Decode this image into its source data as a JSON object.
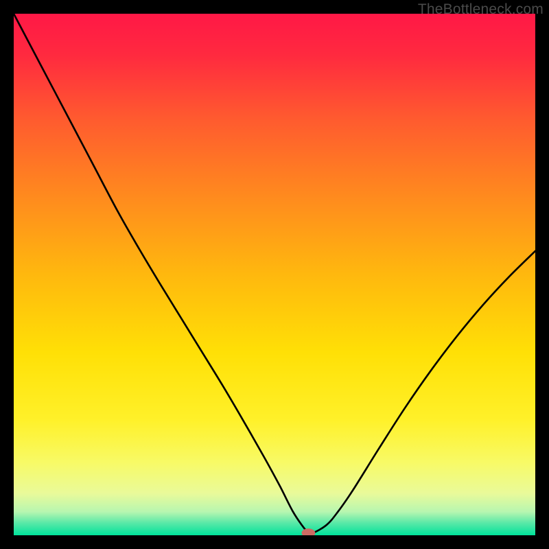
{
  "watermark": "TheBottleneck.com",
  "chart_data": {
    "type": "line",
    "title": "",
    "xlabel": "",
    "ylabel": "",
    "xlim": [
      0,
      100
    ],
    "ylim": [
      0,
      100
    ],
    "background_gradient": {
      "stops": [
        {
          "offset": 0.0,
          "color": "#ff1846"
        },
        {
          "offset": 0.08,
          "color": "#ff2a3f"
        },
        {
          "offset": 0.2,
          "color": "#ff5a2f"
        },
        {
          "offset": 0.35,
          "color": "#ff8a1e"
        },
        {
          "offset": 0.5,
          "color": "#ffb80e"
        },
        {
          "offset": 0.65,
          "color": "#ffe006"
        },
        {
          "offset": 0.78,
          "color": "#fff12a"
        },
        {
          "offset": 0.86,
          "color": "#f8fa66"
        },
        {
          "offset": 0.92,
          "color": "#e9fa9a"
        },
        {
          "offset": 0.955,
          "color": "#b7f6b0"
        },
        {
          "offset": 0.975,
          "color": "#5fe9a8"
        },
        {
          "offset": 1.0,
          "color": "#00e29b"
        }
      ]
    },
    "series": [
      {
        "name": "bottleneck-curve",
        "x": [
          0,
          5,
          10,
          15,
          20,
          24,
          28,
          32,
          36,
          40,
          44,
          48,
          51,
          53.5,
          55.5,
          56.5,
          57.5,
          60,
          62,
          65,
          70,
          75,
          80,
          85,
          90,
          95,
          100
        ],
        "y": [
          100,
          90.5,
          81,
          71.5,
          62,
          55,
          48.3,
          41.8,
          35.3,
          28.8,
          22.0,
          15.0,
          9.5,
          4.6,
          1.6,
          0.6,
          0.5,
          2.0,
          4.3,
          8.6,
          16.6,
          24.4,
          31.6,
          38.2,
          44.2,
          49.6,
          54.5
        ]
      }
    ],
    "marker": {
      "name": "bottleneck-point",
      "x": 56.5,
      "y": 0.45,
      "color": "#cd6b63",
      "rx": 1.3,
      "ry": 0.85
    }
  }
}
